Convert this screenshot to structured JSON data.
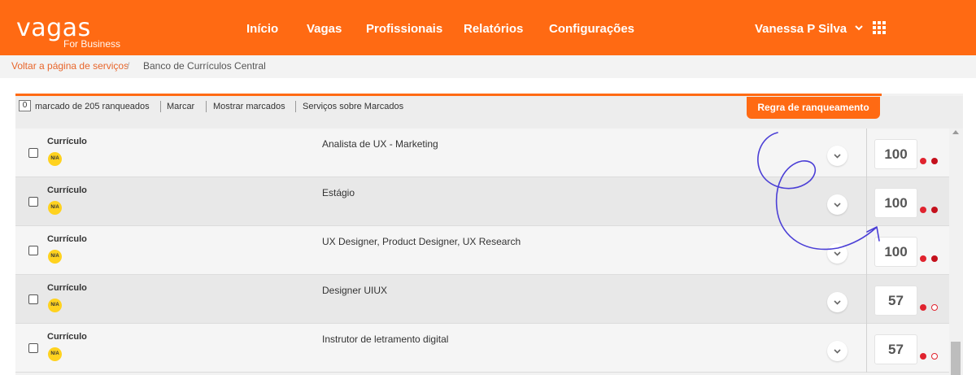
{
  "header": {
    "logo_text": "vagas",
    "logo_subtitle": "For Business",
    "nav": [
      "Início",
      "Vagas",
      "Profissionais",
      "Relatórios",
      "Configurações"
    ],
    "user_name": "Vanessa P Silva",
    "user_chevron_icon": "chevron-down-icon",
    "apps_icon": "apps-grid-icon",
    "brand_color": "#ff6a13"
  },
  "breadcrumb": {
    "back_link": "Voltar a página de serviços",
    "separator": "/",
    "current": "Banco de Currículos Central"
  },
  "toolbar": {
    "marked_count": "0",
    "marked_text": "marcado de 205 ranqueados",
    "mark_label": "Marcar",
    "show_marked_label": "Mostrar marcados",
    "services_label": "Serviços sobre Marcados",
    "ranking_rule_label": "Regra de ranqueamento"
  },
  "rows": [
    {
      "type": "Currículo",
      "badge": "N/A",
      "title": "Analista de UX - Marketing",
      "score": "100",
      "indicator_second": "filled"
    },
    {
      "type": "Currículo",
      "badge": "N/A",
      "title": "Estágio",
      "score": "100",
      "indicator_second": "filled"
    },
    {
      "type": "Currículo",
      "badge": "N/A",
      "title": "UX Designer, Product Designer, UX Research",
      "score": "100",
      "indicator_second": "filled"
    },
    {
      "type": "Currículo",
      "badge": "N/A",
      "title": "Designer UIUX",
      "score": "57",
      "indicator_second": "hollow"
    },
    {
      "type": "Currículo",
      "badge": "N/A",
      "title": "Instrutor de letramento digital",
      "score": "57",
      "indicator_second": "hollow"
    }
  ],
  "annotation": {
    "type": "hand-drawn-arrow",
    "color": "#4b3fd6"
  }
}
